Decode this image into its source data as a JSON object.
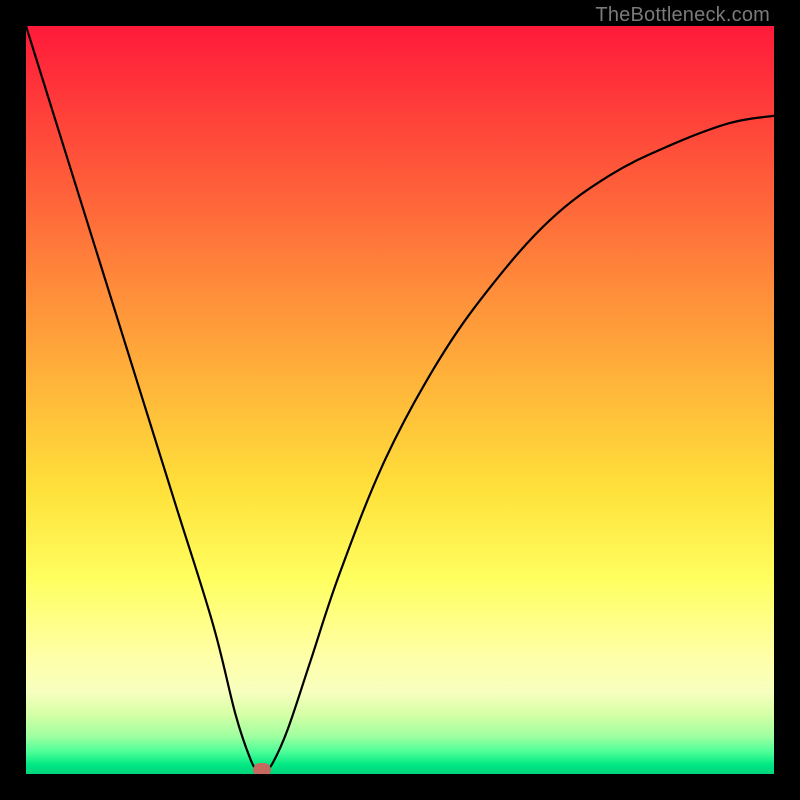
{
  "watermark": "TheBottleneck.com",
  "colors": {
    "frame": "#000000",
    "curve": "#000000",
    "dot": "#c46a5f"
  },
  "chart_data": {
    "type": "line",
    "title": "",
    "xlabel": "",
    "ylabel": "",
    "xlim": [
      0,
      100
    ],
    "ylim": [
      0,
      100
    ],
    "grid": false,
    "legend": false,
    "series": [
      {
        "name": "bottleneck-curve",
        "x": [
          0,
          5,
          10,
          15,
          20,
          25,
          28,
          30,
          31,
          32,
          33,
          35,
          38,
          42,
          48,
          55,
          62,
          70,
          78,
          86,
          94,
          100
        ],
        "y": [
          100,
          84,
          68,
          52,
          36,
          20,
          8,
          2,
          0.5,
          0.5,
          1.5,
          6,
          15,
          27,
          42,
          55,
          65,
          74,
          80,
          84,
          87,
          88
        ]
      }
    ],
    "marker": {
      "x": 31.5,
      "y": 0.5
    },
    "gradient_stops": [
      {
        "pos": 0.0,
        "color": "#ff1a3a"
      },
      {
        "pos": 0.1,
        "color": "#ff3a3a"
      },
      {
        "pos": 0.25,
        "color": "#ff6a3a"
      },
      {
        "pos": 0.35,
        "color": "#ff8c3a"
      },
      {
        "pos": 0.48,
        "color": "#ffb53a"
      },
      {
        "pos": 0.62,
        "color": "#ffe13a"
      },
      {
        "pos": 0.74,
        "color": "#ffff60"
      },
      {
        "pos": 0.84,
        "color": "#ffffa6"
      },
      {
        "pos": 0.89,
        "color": "#f8ffbf"
      },
      {
        "pos": 0.92,
        "color": "#d6ffa6"
      },
      {
        "pos": 0.95,
        "color": "#9effa0"
      },
      {
        "pos": 0.97,
        "color": "#4eff98"
      },
      {
        "pos": 0.988,
        "color": "#00e884"
      },
      {
        "pos": 1.0,
        "color": "#00d47c"
      }
    ]
  }
}
